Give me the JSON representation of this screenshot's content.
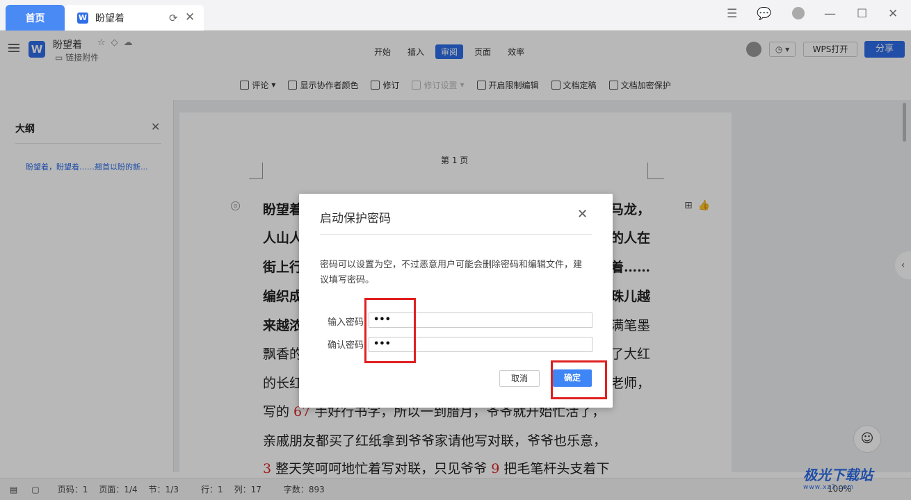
{
  "titlebar": {
    "home_tab": "首页",
    "doc_tab": "盼望着",
    "doc_tab_logo": "W",
    "icons": [
      "list-icon",
      "chat-icon",
      "user-avatar-icon",
      "minimize-icon",
      "maximize-icon",
      "close-icon"
    ]
  },
  "ribbon": {
    "doc_logo": "W",
    "doc_title": "盼望着",
    "doc_sub": "链接附件",
    "tabs": [
      "开始",
      "插入",
      "审阅",
      "页面",
      "效率"
    ],
    "active_tab": "审阅",
    "wps_open": "WPS打开",
    "share": "分享"
  },
  "toolbar": {
    "items": [
      "评论",
      "显示协作者颜色",
      "修订",
      "修订设置",
      "开启限制编辑",
      "文档定稿",
      "文档加密保护"
    ],
    "disabled": "修订设置"
  },
  "outline": {
    "title": "大纲",
    "item": "盼望着，盼望着……翘首以盼的新..."
  },
  "page": {
    "page_label": "第 1 页",
    "lines": [
      {
        "left": "盼望着",
        "right": "马龙，",
        "bold": true
      },
      {
        "left": "人山人",
        "right": "的人在",
        "bold": true
      },
      {
        "left": "街上行",
        "right": "着……",
        "bold": true
      },
      {
        "left": "编织成",
        "right": "珠儿越",
        "bold": true
      },
      {
        "left": "来越浓",
        "right": "满笔墨",
        "bold": false
      },
      {
        "left": "飘香的",
        "right": "了大红",
        "bold": false
      },
      {
        "left": "的长红",
        "right": "老师，",
        "bold": false
      }
    ],
    "full_line_1_pre": "写的 ",
    "full_line_1_red": "67",
    "full_line_1_post": " 手好行书字，所以一到腊月，爷爷就开始忙活了，",
    "full_line_2": "亲戚朋友都买了红纸拿到爷爷家请他写对联，爷爷也乐意，",
    "full_line_3_red1": "3",
    "full_line_3_mid": " 整天笑呵呵地忙着写对联，只见爷爷 ",
    "full_line_3_red2": "9",
    "full_line_3_post": " 把毛笔杆头支着下"
  },
  "dialog": {
    "title": "启动保护密码",
    "description": "密码可以设置为空，不过恶意用户可能会删除密码和编辑文件，建议填写密码。",
    "password_label": "输入密码",
    "password_value": "•••",
    "confirm_label": "确认密码",
    "confirm_value": "•••",
    "cancel": "取消",
    "ok": "确定"
  },
  "status": {
    "page_code": "页码：1",
    "page": "页面：1/4",
    "section": "节：1/3",
    "row": "行：1",
    "col": "列：17",
    "words": "字数：893",
    "zoom": "100%"
  },
  "watermark": {
    "text": "极光下载站",
    "sub": "www.xz7.com"
  },
  "colors": {
    "accent": "#2f6ee8",
    "highlight_box": "#e02020",
    "ok_button": "#3e86f5"
  }
}
